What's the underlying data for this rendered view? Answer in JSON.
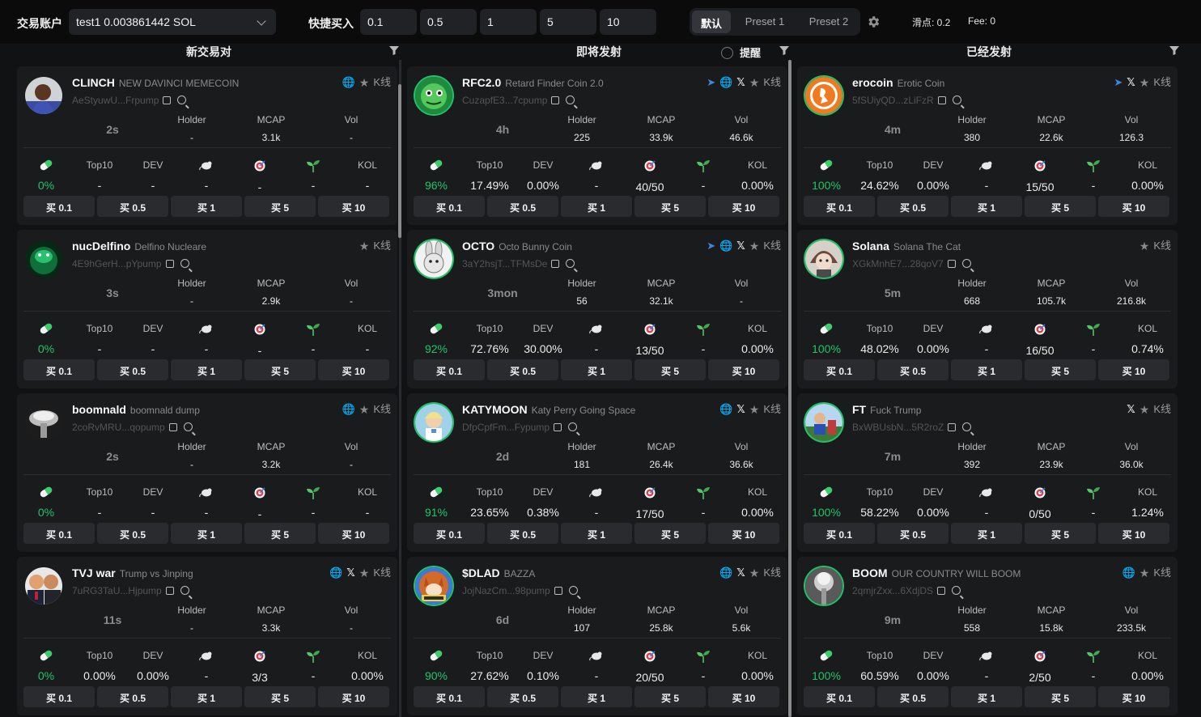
{
  "header": {
    "account_label": "交易账户",
    "account_value": "test1 0.003861442 SOL",
    "quick_buy_label": "快捷买入",
    "amounts": [
      "0.1",
      "0.5",
      "1",
      "5",
      "10"
    ],
    "presets": [
      "默认",
      "Preset 1",
      "Preset 2"
    ],
    "active_preset": "默认",
    "settings_icon": "gear-icon",
    "slippage": "滑点: 0.2",
    "fee": "Fee: 0"
  },
  "columns": [
    {
      "title": "新交易对"
    },
    {
      "title": "即将发射",
      "remind_label": "提醒"
    },
    {
      "title": "已经发射"
    }
  ],
  "labels": {
    "holder": "Holder",
    "mcap": "MCAP",
    "vol": "Vol",
    "top10": "Top10",
    "dev": "DEV",
    "kol": "KOL",
    "kline": "K线",
    "buy": [
      "买 0.1",
      "买 0.5",
      "买 1",
      "买 5",
      "买 10"
    ]
  },
  "colors": {
    "accent_green": "#1fc46a",
    "card_bg": "#1a1b1d",
    "page_bg": "#111214",
    "web_icon": "#3b63e6",
    "telegram_icon": "#3f86dd"
  },
  "cards": [
    {
      "symbol": "CLINCH",
      "name": "NEW DAVINCI MEMECOIN",
      "address": "AeStyuwU...Frpump",
      "age": "2s",
      "holder": "-",
      "mcap": "3.1k",
      "vol": "-",
      "pct": "0%",
      "top10": "-",
      "dev": "-",
      "rat": "-",
      "snipers": "-",
      "sprout": "-",
      "kol": "-",
      "links": [
        "web",
        "star",
        "kline"
      ]
    },
    {
      "symbol": "nucDelfino",
      "name": "Delfino Nucleare",
      "address": "4E9hGerH...pYpump",
      "age": "3s",
      "holder": "-",
      "mcap": "2.9k",
      "vol": "-",
      "pct": "0%",
      "top10": "-",
      "dev": "-",
      "rat": "-",
      "snipers": "-",
      "sprout": "-",
      "kol": "-",
      "links": [
        "star",
        "kline"
      ]
    },
    {
      "symbol": "boomnald",
      "name": "boomnald dump",
      "address": "2coRvMRU...qopump",
      "age": "2s",
      "holder": "-",
      "mcap": "3.2k",
      "vol": "-",
      "pct": "0%",
      "top10": "-",
      "dev": "-",
      "rat": "-",
      "snipers": "-",
      "sprout": "-",
      "kol": "-",
      "links": [
        "web",
        "star",
        "kline"
      ]
    },
    {
      "symbol": "TVJ war",
      "name": "Trump vs Jinping",
      "address": "7uRG3TaU...Hjpump",
      "age": "11s",
      "holder": "-",
      "mcap": "3.3k",
      "vol": "-",
      "pct": "0%",
      "top10": "0.00%",
      "dev": "0.00%",
      "rat": "-",
      "snipers": "3/3",
      "sprout": "-",
      "kol": "0.00%",
      "links": [
        "web",
        "x",
        "star",
        "kline"
      ]
    },
    {
      "symbol": "RFC2.0",
      "name": "Retard Finder Coin 2.0",
      "address": "CuzapfE3...7cpump",
      "age": "4h",
      "holder": "225",
      "mcap": "33.9k",
      "vol": "46.6k",
      "pct": "96%",
      "top10": "17.49%",
      "dev": "0.00%",
      "rat": "-",
      "snipers": "40/50",
      "sprout": "-",
      "kol": "0.00%",
      "links": [
        "tg",
        "web",
        "x",
        "star",
        "kline"
      ]
    },
    {
      "symbol": "OCTO",
      "name": "Octo Bunny Coin",
      "address": "3aY2hsjT...TFMsDe",
      "age": "3mon",
      "holder": "56",
      "mcap": "32.1k",
      "vol": "-",
      "pct": "92%",
      "top10": "72.76%",
      "dev": "30.00%",
      "rat": "-",
      "snipers": "13/50",
      "sprout": "-",
      "kol": "0.00%",
      "links": [
        "tg",
        "web",
        "x",
        "star",
        "kline"
      ]
    },
    {
      "symbol": "KATYMOON",
      "name": "Katy Perry Going Space",
      "address": "DfpCpfFm...Fypump",
      "age": "2d",
      "holder": "181",
      "mcap": "26.4k",
      "vol": "36.6k",
      "pct": "91%",
      "top10": "23.65%",
      "dev": "0.38%",
      "rat": "-",
      "snipers": "17/50",
      "sprout": "-",
      "kol": "0.00%",
      "links": [
        "web",
        "x",
        "star",
        "kline"
      ]
    },
    {
      "symbol": "$DLAD",
      "name": "BAZZA",
      "address": "JojNazCm...98pump",
      "age": "6d",
      "holder": "107",
      "mcap": "25.8k",
      "vol": "5.6k",
      "pct": "90%",
      "top10": "27.62%",
      "dev": "0.10%",
      "rat": "-",
      "snipers": "20/50",
      "sprout": "-",
      "kol": "0.00%",
      "links": [
        "web",
        "x",
        "star",
        "kline"
      ]
    },
    {
      "symbol": "erocoin",
      "name": "Erotic Coin",
      "address": "5fSUiyQD...zLiFzR",
      "age": "4m",
      "holder": "380",
      "mcap": "22.6k",
      "vol": "126.3",
      "pct": "100%",
      "top10": "24.62%",
      "dev": "0.00%",
      "rat": "-",
      "snipers": "15/50",
      "sprout": "-",
      "kol": "0.00%",
      "links": [
        "tg",
        "x",
        "star",
        "kline"
      ]
    },
    {
      "symbol": "Solana",
      "name": "Solana The Cat",
      "address": "XGkMnhE7...28qoV7",
      "age": "5m",
      "holder": "668",
      "mcap": "105.7k",
      "vol": "216.8k",
      "pct": "100%",
      "top10": "48.02%",
      "dev": "0.00%",
      "rat": "-",
      "snipers": "16/50",
      "sprout": "-",
      "kol": "0.74%",
      "links": [
        "star",
        "kline"
      ]
    },
    {
      "symbol": "FT",
      "name": "Fuck Trump",
      "address": "BxWBUsbN...5R2roZ",
      "age": "7m",
      "holder": "392",
      "mcap": "23.9k",
      "vol": "36.0k",
      "pct": "100%",
      "top10": "58.22%",
      "dev": "0.00%",
      "rat": "-",
      "snipers": "0/50",
      "sprout": "-",
      "kol": "1.24%",
      "links": [
        "x",
        "star",
        "kline"
      ]
    },
    {
      "symbol": "BOOM",
      "name": "OUR COUNTRY WILL BOOM",
      "address": "2qmjrZxx...6XdjDS",
      "age": "9m",
      "holder": "558",
      "mcap": "15.8k",
      "vol": "233.5k",
      "pct": "100%",
      "top10": "60.59%",
      "dev": "0.00%",
      "rat": "-",
      "snipers": "2/50",
      "sprout": "-",
      "kol": "0.00%",
      "links": [
        "web",
        "star",
        "kline"
      ]
    }
  ]
}
